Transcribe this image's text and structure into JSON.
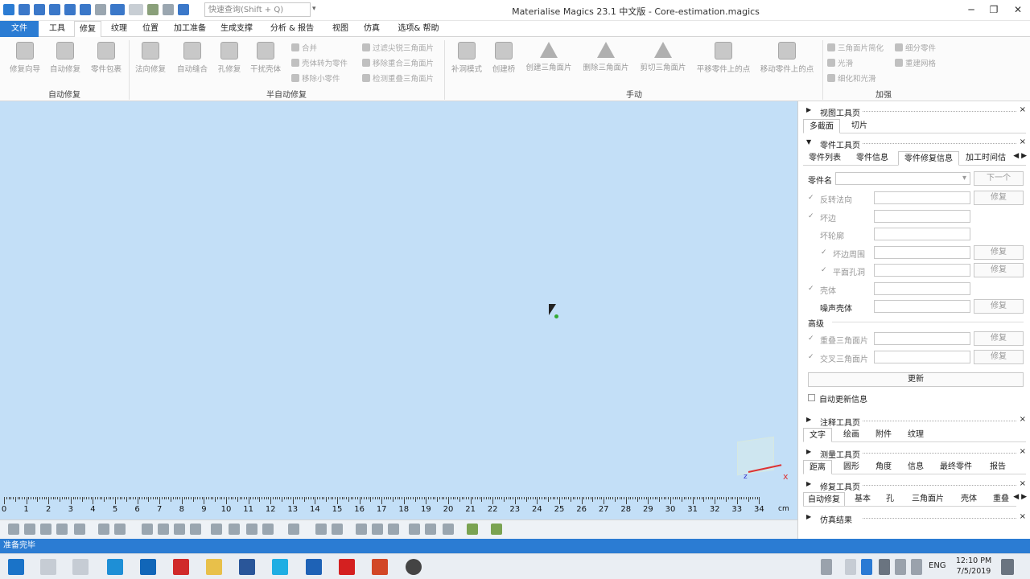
{
  "window": {
    "title": "Materialise Magics 23.1 中文版 - Core-estimation.magics",
    "search_placeholder": "快速查询(Shift + Q)",
    "min": "─",
    "max": "❐",
    "close": "✕"
  },
  "menu_tabs": [
    "文件",
    "工具",
    "修复",
    "纹理",
    "位置",
    "加工准备",
    "生成支撑",
    "分析 & 报告",
    "视图",
    "仿真",
    "选项& 帮助"
  ],
  "ribbon": {
    "auto_repair": {
      "label": "自动修复",
      "buttons": [
        "修复向导",
        "自动修复",
        "零件包裹"
      ]
    },
    "semi_auto": {
      "label": "半自动修复",
      "buttons": [
        "法向修复",
        "自动缝合",
        "孔修复",
        "干扰壳体"
      ],
      "small_col1": [
        "合并",
        "壳体转为零件",
        "移除小零件"
      ],
      "small_col2": [
        "过滤尖锐三角面片",
        "移除重合三角面片",
        "检测重叠三角面片"
      ]
    },
    "manual": {
      "label": "手动",
      "buttons": [
        "补洞模式",
        "创建桥",
        "创建三角面片",
        "删除三角面片",
        "剪切三角面片",
        "平移零件上的点",
        "移动零件上的点"
      ]
    },
    "advanced": {
      "label": "加强",
      "small_col1": [
        "三角面片简化",
        "光滑",
        "细化和光滑"
      ],
      "small_col2": [
        "细分零件",
        "重建网格"
      ]
    }
  },
  "ruler": {
    "unit": "cm",
    "numbers": [
      "0",
      "1",
      "2",
      "3",
      "4",
      "5",
      "6",
      "7",
      "8",
      "9",
      "10",
      "11",
      "12",
      "13",
      "14",
      "15",
      "16",
      "17",
      "18",
      "19",
      "20",
      "21",
      "22",
      "23",
      "24",
      "25",
      "26",
      "27",
      "28",
      "29",
      "30",
      "31",
      "32",
      "33",
      "34"
    ]
  },
  "status": "准备完毕",
  "panel": {
    "view_toolbar": {
      "title": "视图工具页",
      "tabs": [
        "多截面",
        "切片"
      ]
    },
    "part_toolbar": {
      "title": "零件工具页",
      "tabs": [
        "零件列表",
        "零件信息",
        "零件修复信息",
        "加工时间估"
      ],
      "part_name_label": "零件名",
      "next_button": "下一个",
      "rows": [
        {
          "label": "反转法向",
          "button": "修复",
          "check": "✓"
        },
        {
          "label": "坏边",
          "button": "",
          "check": "✓"
        },
        {
          "label": "坏轮廓",
          "button": "",
          "check": ""
        },
        {
          "label": "坏边周围",
          "button": "修复",
          "check": "✓"
        },
        {
          "label": "平面孔洞",
          "button": "修复",
          "check": "✓"
        },
        {
          "label": "壳体",
          "button": "",
          "check": "✓"
        },
        {
          "label": "噪声壳体",
          "button": "修复",
          "check": ""
        }
      ],
      "advanced_label": "高级",
      "advanced_rows": [
        {
          "label": "重叠三角面片",
          "button": "修复",
          "check": "✓"
        },
        {
          "label": "交叉三角面片",
          "button": "修复",
          "check": "✓"
        }
      ],
      "update_button": "更新",
      "auto_update_label": "自动更新信息"
    },
    "annotation_toolbar": {
      "title": "注释工具页",
      "tabs": [
        "文字",
        "绘画",
        "附件",
        "纹理"
      ]
    },
    "measure_toolbar": {
      "title": "测量工具页",
      "tabs": [
        "距离",
        "圆形",
        "角度",
        "信息",
        "最终零件",
        "报告"
      ]
    },
    "repair_toolbar": {
      "title": "修复工具页",
      "tabs": [
        "自动修复",
        "基本",
        "孔",
        "三角面片",
        "壳体",
        "重叠"
      ]
    },
    "sim_results": {
      "title": "仿真结果"
    }
  },
  "taskbar": {
    "lang": "ENG",
    "time": "12:10 PM",
    "date": "7/5/2019"
  },
  "colors": {
    "accent": "#2b7cd3",
    "viewport": "#c3dff7"
  }
}
